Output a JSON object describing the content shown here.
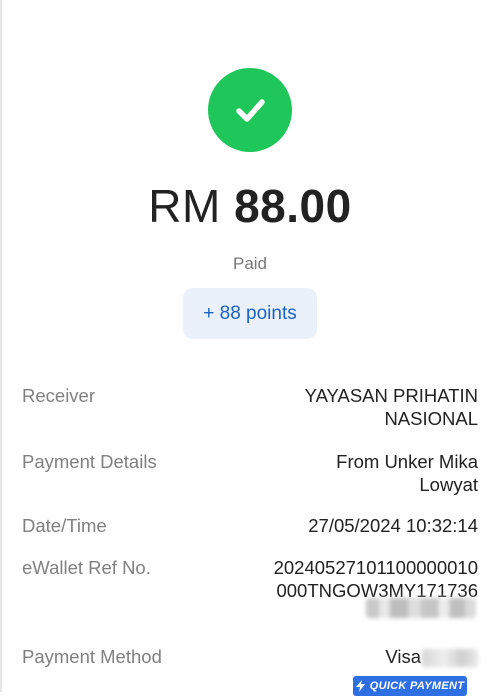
{
  "receipt": {
    "currency": "RM",
    "amount": "88.00",
    "status": "Paid",
    "points": "+ 88 points"
  },
  "details": [
    {
      "label": "Receiver",
      "value": "YAYASAN PRIHATIN\nNASIONAL"
    },
    {
      "label": "Payment Details",
      "value": "From Unker Mika\nLowyat"
    },
    {
      "label": "Date/Time",
      "value": "27/05/2024 10:32:14"
    },
    {
      "label": "eWallet Ref No.",
      "value": "20240527101100000010\n000TNGOW3MY171736"
    },
    {
      "label": "Payment Method",
      "value": "Visa"
    }
  ],
  "badge": {
    "quick_payment": "QUICK PAYMENT",
    "icon": "lightning-icon"
  },
  "icons": {
    "success": "checkmark-icon"
  },
  "colors": {
    "success": "#1fc65a",
    "accent_blue": "#1b63c5",
    "pill_background": "#eaf1fb",
    "badge_blue": "#2f6fe4"
  }
}
